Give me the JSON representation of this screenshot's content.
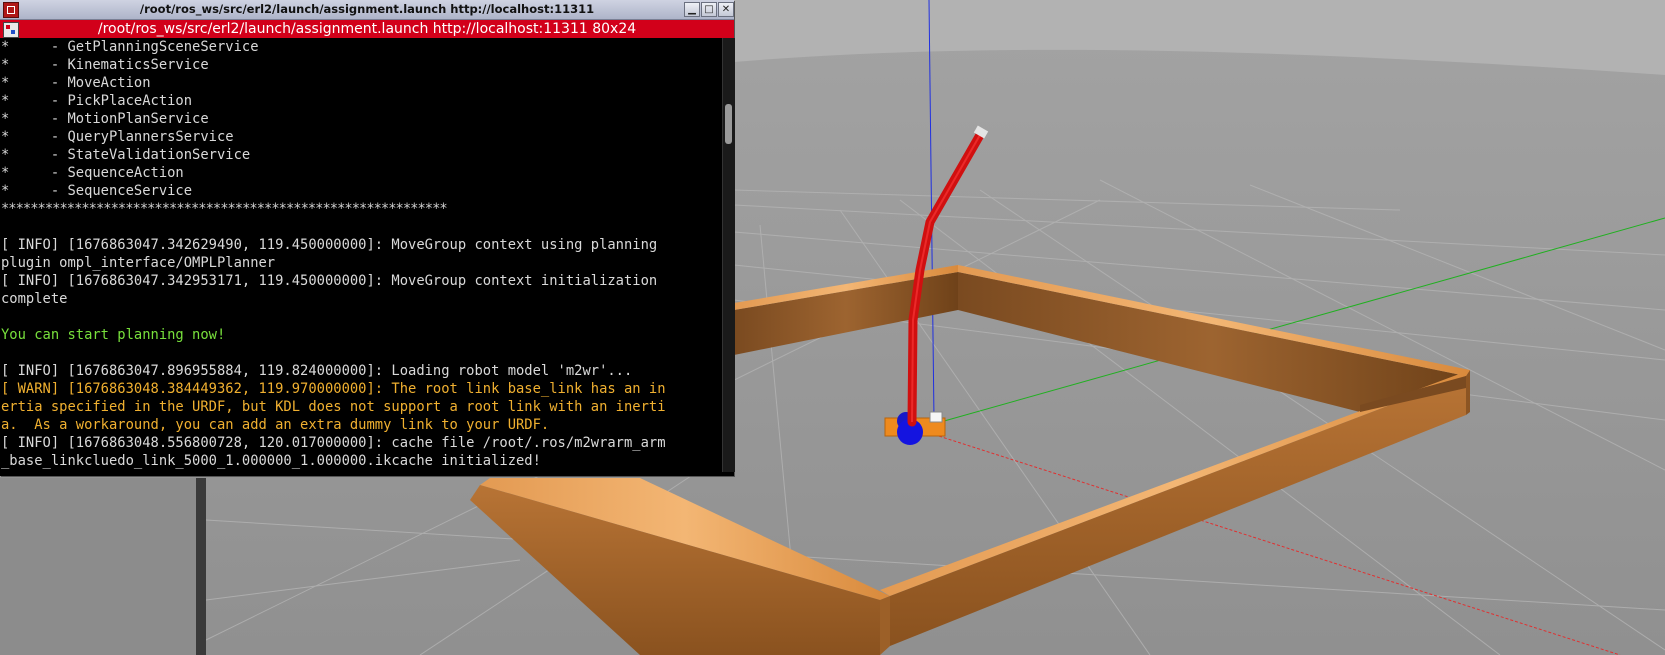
{
  "window": {
    "title": "/root/ros_ws/src/erl2/launch/assignment.launch http://localhost:11311",
    "buttons": {
      "minimize": "▁",
      "maximize": "□",
      "close": "✕"
    }
  },
  "tab": {
    "title": "/root/ros_ws/src/erl2/launch/assignment.launch http://localhost:11311 80x24"
  },
  "terminal": {
    "lines": [
      {
        "text": "*     - GetPlanningSceneService",
        "style": "normal"
      },
      {
        "text": "*     - KinematicsService",
        "style": "normal"
      },
      {
        "text": "*     - MoveAction",
        "style": "normal"
      },
      {
        "text": "*     - PickPlaceAction",
        "style": "normal"
      },
      {
        "text": "*     - MotionPlanService",
        "style": "normal"
      },
      {
        "text": "*     - QueryPlannersService",
        "style": "normal"
      },
      {
        "text": "*     - StateValidationService",
        "style": "normal"
      },
      {
        "text": "*     - SequenceAction",
        "style": "normal"
      },
      {
        "text": "*     - SequenceService",
        "style": "normal"
      },
      {
        "text": "*************************************************************",
        "style": "stars"
      },
      {
        "text": "",
        "style": "normal"
      },
      {
        "text": "[ INFO] [1676863047.342629490, 119.450000000]: MoveGroup context using planning",
        "style": "normal"
      },
      {
        "text": "plugin ompl_interface/OMPLPlanner",
        "style": "normal"
      },
      {
        "text": "[ INFO] [1676863047.342953171, 119.450000000]: MoveGroup context initialization",
        "style": "normal"
      },
      {
        "text": "complete",
        "style": "normal"
      },
      {
        "text": "",
        "style": "normal"
      },
      {
        "text": "You can start planning now!",
        "style": "green"
      },
      {
        "text": "",
        "style": "normal"
      },
      {
        "text": "[ INFO] [1676863047.896955884, 119.824000000]: Loading robot model 'm2wr'...",
        "style": "normal"
      },
      {
        "text": "[ WARN] [1676863048.384449362, 119.970000000]: The root link base_link has an in",
        "style": "warn"
      },
      {
        "text": "ertia specified in the URDF, but KDL does not support a root link with an inerti",
        "style": "warn"
      },
      {
        "text": "a.  As a workaround, you can add an extra dummy link to your URDF.",
        "style": "warn"
      },
      {
        "text": "[ INFO] [1676863048.556800728, 120.017000000]: cache file /root/.ros/m2wrarm_arm",
        "style": "normal"
      },
      {
        "text": "_base_linkcluedo_link_5000_1.000000_1.000000.ikcache initialized!",
        "style": "normal"
      }
    ]
  },
  "colors": {
    "tab_bar": "#d2001a",
    "terminal_bg": "#000000",
    "terminal_text": "#d9d9d9",
    "warn_text": "#f0b030",
    "success_text": "#78e03c",
    "floor": "#9a9a9a",
    "wood": "#b8742e",
    "robot_arm": "#d01010",
    "robot_base": "#ee8a1e",
    "axis_x": "#e03030",
    "axis_y": "#20b020",
    "axis_z": "#2030e0"
  },
  "icons": {
    "app": "terminal-app-icon",
    "tab": "terminal-tab-icon"
  }
}
